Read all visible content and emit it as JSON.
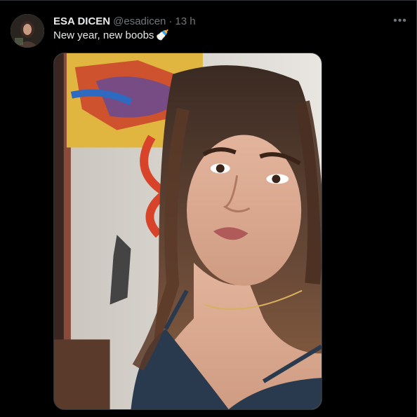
{
  "tweet": {
    "display_name": "ESA DICEN",
    "handle": "@esadicen",
    "separator": "·",
    "time": "13 h",
    "text": "New year, new boobs",
    "emoji": "🍼",
    "more_icon": "more-dots-icon"
  }
}
